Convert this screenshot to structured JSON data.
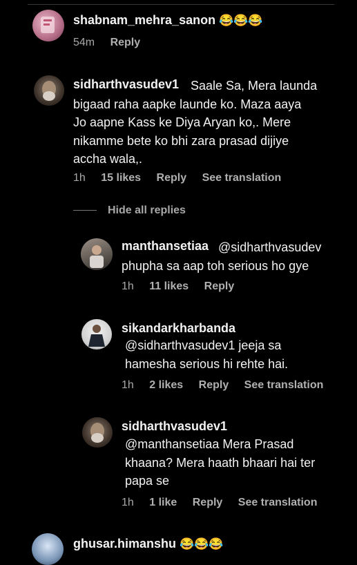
{
  "comments": [
    {
      "username": "shabnam_mehra_sanon",
      "emoji": "😂😂😂",
      "time": "54m",
      "reply": "Reply"
    },
    {
      "username": "sidharthvasudev1",
      "text": "Saale Sa, Mera launda\nbigaad raha aapke launde ko. Maza aaya\nJo aapne Kass ke Diya Aryan ko,. Mere\nnikamme bete ko bhi zara prasad dijiye\naccha wala,.",
      "time": "1h",
      "likes": "15 likes",
      "reply": "Reply",
      "translate": "See translation"
    }
  ],
  "hide_replies": "Hide all replies",
  "replies": [
    {
      "username": "manthansetiaa",
      "text": "@sidharthvasudev\nphupha sa aap toh serious ho gye",
      "time": "1h",
      "likes": "11 likes",
      "reply": "Reply"
    },
    {
      "username": "sikandarkharbanda",
      "text": "@sidharthvasudev1 jeeja sa\nhamesha serious hi rehte hai.",
      "time": "1h",
      "likes": "2 likes",
      "reply": "Reply",
      "translate": "See translation"
    },
    {
      "username": "sidharthvasudev1",
      "text": "@manthansetiaa Mera Prasad\nkhaana? Mera haath bhaari hai ter\npapa se",
      "time": "1h",
      "likes": "1 like",
      "reply": "Reply",
      "translate": "See translation"
    }
  ],
  "last_comment": {
    "username": "ghusar.himanshu",
    "emoji": "😂😂😂"
  },
  "colors": {
    "background": "#000000",
    "text": "#f2f2f2",
    "muted": "#a8a8a8"
  }
}
